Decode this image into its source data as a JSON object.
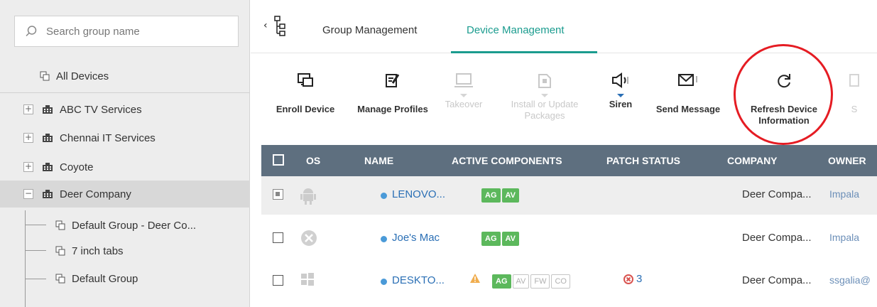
{
  "sidebar": {
    "search_placeholder": "Search group name",
    "all_devices": "All Devices",
    "groups": [
      {
        "label": "ABC TV Services",
        "toggle": "+"
      },
      {
        "label": "Chennai IT Services",
        "toggle": "+"
      },
      {
        "label": "Coyote",
        "toggle": "+"
      },
      {
        "label": "Deer Company",
        "toggle": "−"
      }
    ],
    "subgroups": [
      {
        "label": "Default Group - Deer Co..."
      },
      {
        "label": "7 inch tabs"
      },
      {
        "label": "Default Group"
      }
    ]
  },
  "tabs": [
    {
      "label": "Group Management",
      "active": false
    },
    {
      "label": "Device Management",
      "active": true
    }
  ],
  "toolbar": [
    {
      "icon": "enroll-device-icon",
      "label": "Enroll Device",
      "enabled": true
    },
    {
      "icon": "manage-profiles-icon",
      "label": "Manage Profiles",
      "enabled": true
    },
    {
      "icon": "takeover-icon",
      "label": "Takeover",
      "enabled": false
    },
    {
      "icon": "install-packages-icon",
      "label": "Install or Update Packages",
      "enabled": false
    },
    {
      "icon": "siren-icon",
      "label": "Siren",
      "enabled": true
    },
    {
      "icon": "send-message-icon",
      "label": "Send Message",
      "enabled": true
    },
    {
      "icon": "refresh-icon",
      "label": "Refresh Device Information",
      "enabled": true
    },
    {
      "icon": "more-icon",
      "label": "S",
      "enabled": false
    }
  ],
  "table": {
    "columns": [
      "OS",
      "NAME",
      "ACTIVE COMPONENTS",
      "PATCH STATUS",
      "COMPANY",
      "OWNER"
    ],
    "rows": [
      {
        "os": "android-icon",
        "name": "LENOVO...",
        "components": [
          {
            "t": "AG",
            "on": true
          },
          {
            "t": "AV",
            "on": true
          }
        ],
        "warning": false,
        "patch": "",
        "company": "Deer Compa...",
        "owner": "Impala"
      },
      {
        "os": "mac-icon",
        "name": "Joe's Mac",
        "components": [
          {
            "t": "AG",
            "on": true
          },
          {
            "t": "AV",
            "on": true
          }
        ],
        "warning": false,
        "patch": "",
        "company": "Deer Compa...",
        "owner": "Impala"
      },
      {
        "os": "windows-icon",
        "name": "DESKTO...",
        "components": [
          {
            "t": "AG",
            "on": true
          },
          {
            "t": "AV",
            "on": false
          },
          {
            "t": "FW",
            "on": false
          },
          {
            "t": "CO",
            "on": false
          }
        ],
        "warning": true,
        "patch": "3",
        "company": "Deer Compa...",
        "owner": "ssgalia@"
      }
    ]
  },
  "colors": {
    "accent": "#1b9c8f",
    "link": "#2a6fb5",
    "header_bg": "#5e6f7f",
    "highlight": "#e51c23",
    "badge_on": "#5cb85c"
  }
}
